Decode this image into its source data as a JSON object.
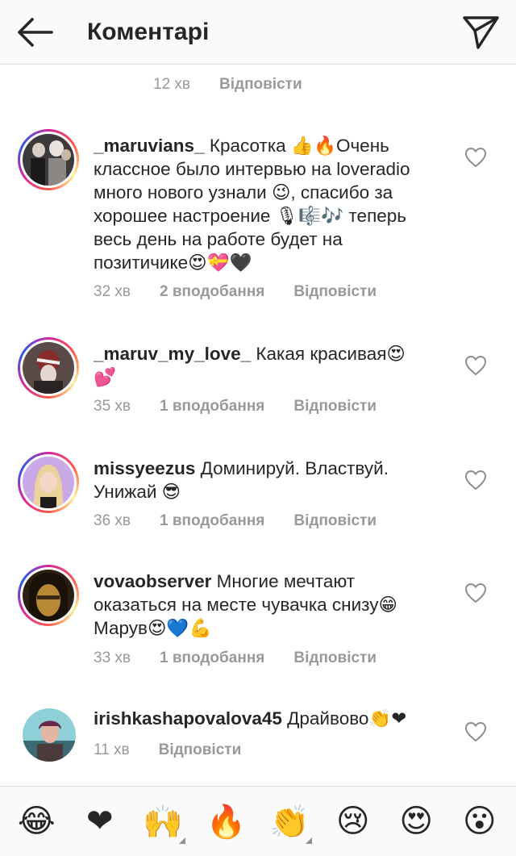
{
  "header": {
    "title": "Коментарі",
    "back_icon": "arrow-left-icon",
    "send_icon": "paper-plane-icon"
  },
  "top_meta": {
    "time": "12 хв",
    "reply": "Відповісти"
  },
  "comments": [
    {
      "username": "_maruvians_",
      "text": "Красотка 👍🔥Очень классное было интервью  на loveradio много нового узнали 😉, спасибо за хорошее настроение 🎙🎼🎶 теперь весь день на работе будет на позитичике😍💝🖤",
      "time": "32 хв",
      "likes": "2 вподобання",
      "reply": "Відповісти",
      "story_ring": true
    },
    {
      "username": "_maruv_my_love_",
      "text": "Какая красивая😍💕",
      "time": "35 хв",
      "likes": "1 вподобання",
      "reply": "Відповісти",
      "story_ring": true
    },
    {
      "username": "missyeezus",
      "text": "Доминируй. Властвуй. Унижай 😎",
      "time": "36 хв",
      "likes": "1 вподобання",
      "reply": "Відповісти",
      "story_ring": true
    },
    {
      "username": "vovaobserver",
      "text": "Многие мечтают оказаться на месте чувачка снизу😁 Марув😍💙💪",
      "time": "33 хв",
      "likes": "1 вподобання",
      "reply": "Відповісти",
      "story_ring": true
    },
    {
      "username": "irishkashapovalova45",
      "text": "Драйвово👏❤",
      "time": "11 хв",
      "likes": "",
      "reply": "Відповісти",
      "story_ring": false
    }
  ],
  "emoji_bar": [
    "😂",
    "❤",
    "🙌",
    "🔥",
    "👏",
    "😢",
    "😍",
    "😮"
  ],
  "colors": {
    "text": "#262626",
    "meta": "#999999",
    "border": "#dbdbdb",
    "like": "#8e8e8e"
  }
}
